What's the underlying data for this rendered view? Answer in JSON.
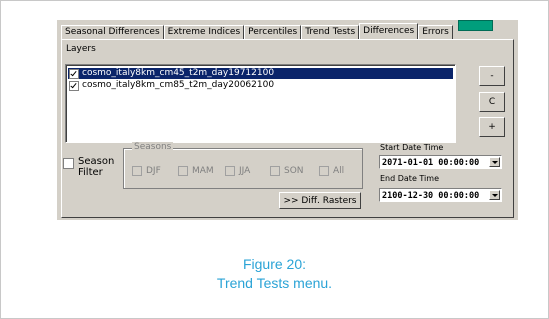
{
  "tabs": [
    {
      "label": "Seasonal Differences",
      "active": false
    },
    {
      "label": "Extreme Indices",
      "active": false
    },
    {
      "label": "Percentiles",
      "active": false
    },
    {
      "label": "Trend Tests",
      "active": false
    },
    {
      "label": "Differences",
      "active": true
    },
    {
      "label": "Errors",
      "active": false
    }
  ],
  "layers": {
    "label": "Layers",
    "items": [
      {
        "name": "cosmo_italy8km_cm45_t2m_day19712100",
        "checked": true,
        "selected": true
      },
      {
        "name": "cosmo_italy8km_cm85_t2m_day20062100",
        "checked": true,
        "selected": false
      }
    ]
  },
  "side_buttons": {
    "remove": "-",
    "clear": "C",
    "add": "+"
  },
  "season_filter": {
    "label_line1": "Season",
    "label_line2": "Filter",
    "checked": false
  },
  "seasons": {
    "title": "Seasons",
    "options": [
      "DJF",
      "MAM",
      "JJA",
      "SON",
      "All"
    ]
  },
  "start_date": {
    "label": "Start Date Time",
    "value": "2071-01-01 00:00:00"
  },
  "end_date": {
    "label": "End Date Time",
    "value": "2100-12-30 00:00:00"
  },
  "diff_button": ">> Diff. Rasters",
  "caption": {
    "line1": "Figure 20:",
    "line2": "Trend Tests menu."
  },
  "colors": {
    "dialog_bg": "#d4d0c8",
    "selection": "#0a246a",
    "accent_tab_button": "#009e7c",
    "caption_text": "#2aa3d6"
  }
}
